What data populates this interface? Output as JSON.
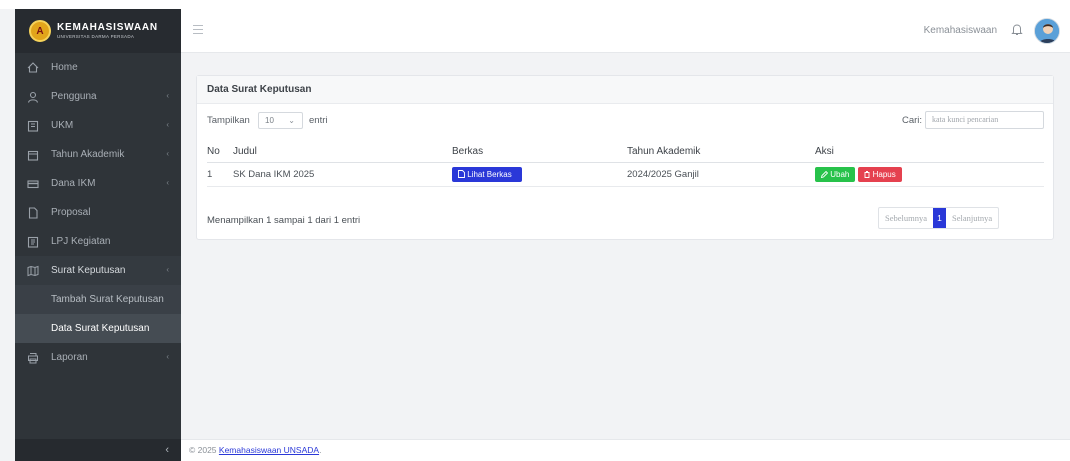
{
  "brand": {
    "title": "KEMAHASISWAAN",
    "subtitle": "UNIVERSITAS DARMA PERSADA"
  },
  "sidebar": {
    "items": [
      {
        "label": "Home",
        "icon": "home-icon"
      },
      {
        "label": "Pengguna",
        "icon": "user-icon"
      },
      {
        "label": "UKM",
        "icon": "building-icon"
      },
      {
        "label": "Tahun Akademik",
        "icon": "calendar-icon"
      },
      {
        "label": "Dana IKM",
        "icon": "money-icon"
      },
      {
        "label": "Proposal",
        "icon": "file-icon"
      },
      {
        "label": "LPJ Kegiatan",
        "icon": "report-icon"
      },
      {
        "label": "Surat Keputusan",
        "icon": "map-icon"
      },
      {
        "label": "Laporan",
        "icon": "printer-icon"
      }
    ],
    "sub_items": [
      {
        "label": "Tambah Surat Keputusan"
      },
      {
        "label": "Data Surat Keputusan"
      }
    ],
    "collapse_symbol": "‹"
  },
  "header": {
    "user_name": "Kemahasiswaan"
  },
  "card": {
    "title": "Data Surat Keputusan",
    "show_label": "Tampilkan",
    "page_size": "10",
    "entries_label": "entri",
    "search_label": "Cari:",
    "search_placeholder": "kata kunci pencarian",
    "columns": [
      "No",
      "Judul",
      "Berkas",
      "Tahun Akademik",
      "Aksi"
    ],
    "rows": [
      {
        "no": "1",
        "judul": "SK Dana IKM 2025",
        "berkas": "Lihat Berkas",
        "tahun": "2024/2025 Ganjil",
        "ubah": "Ubah",
        "hapus": "Hapus"
      }
    ],
    "info": "Menampilkan 1 sampai 1 dari 1 entri",
    "pager": {
      "prev": "Sebelumnya",
      "current": "1",
      "next": "Selanjutnya"
    }
  },
  "footer": {
    "prefix": "© 2025",
    "link": "Kemahasiswaan UNSADA",
    "suffix": "."
  },
  "colors": {
    "sidebar_bg": "#2f3439",
    "primary": "#2a38d8",
    "success": "#27c24a",
    "danger": "#e5414f"
  }
}
